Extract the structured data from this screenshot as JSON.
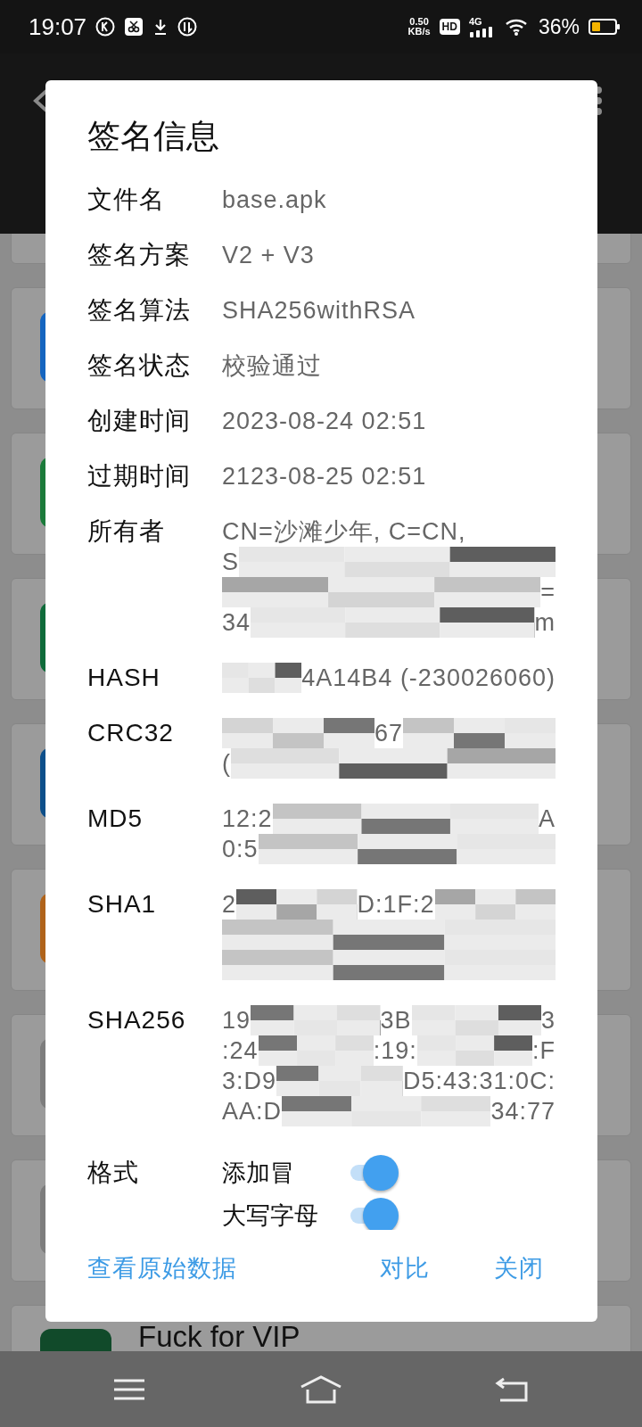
{
  "status_bar": {
    "time": "19:07",
    "net_speed": "0.50",
    "net_unit": "KB/s",
    "hd": "HD",
    "network": "4G",
    "battery": "36%"
  },
  "background_list": {
    "cards": [
      {
        "kind": "partial"
      },
      {
        "color": "#1565c0"
      },
      {
        "color": "#1b7a3a"
      },
      {
        "color": "#0f6b3a"
      },
      {
        "color": "#0d4f8a"
      },
      {
        "color": "#b0631a"
      },
      {
        "color": "#7d7d7d"
      },
      {
        "color": "#7d7d7d"
      },
      {
        "color": "#114a2a",
        "title": "Fuck for VIP"
      }
    ]
  },
  "dialog": {
    "title": "签名信息",
    "rows": [
      {
        "label": "文件名",
        "lines": [
          [
            {
              "kind": "text",
              "text": "base.apk"
            }
          ]
        ]
      },
      {
        "label": "签名方案",
        "lines": [
          [
            {
              "kind": "text",
              "text": "V2 + V3"
            }
          ]
        ]
      },
      {
        "label": "签名算法",
        "lines": [
          [
            {
              "kind": "text",
              "text": "SHA256withRSA"
            }
          ]
        ]
      },
      {
        "label": "签名状态",
        "lines": [
          [
            {
              "kind": "text",
              "text": "校验通过"
            }
          ]
        ]
      },
      {
        "label": "创建时间",
        "lines": [
          [
            {
              "kind": "text",
              "text": "2023-08-24 02:51"
            }
          ]
        ]
      },
      {
        "label": "过期时间",
        "lines": [
          [
            {
              "kind": "text",
              "text": "2123-08-25 02:51"
            }
          ]
        ]
      },
      {
        "label": "所有者",
        "lines": [
          [
            {
              "kind": "text",
              "text": "CN=沙滩少年, C=CN,"
            }
          ],
          [
            {
              "kind": "text",
              "text": "S"
            },
            {
              "kind": "mosaic"
            }
          ],
          [
            {
              "kind": "mosaic"
            },
            {
              "kind": "text",
              "text": "="
            }
          ],
          [
            {
              "kind": "text",
              "text": "34"
            },
            {
              "kind": "mosaic"
            },
            {
              "kind": "text",
              "text": "m"
            }
          ]
        ]
      },
      {
        "label": "HASH",
        "lines": [
          [
            {
              "kind": "mosaic"
            },
            {
              "kind": "text",
              "text": "4A14B4 (-230026060)"
            }
          ]
        ]
      },
      {
        "label": "CRC32",
        "lines": [
          [
            {
              "kind": "mosaic"
            },
            {
              "kind": "text",
              "text": "67"
            },
            {
              "kind": "mosaic"
            }
          ],
          [
            {
              "kind": "text",
              "text": "("
            },
            {
              "kind": "mosaic"
            }
          ]
        ]
      },
      {
        "label": "MD5",
        "lines": [
          [
            {
              "kind": "text",
              "text": "12:2"
            },
            {
              "kind": "mosaic"
            },
            {
              "kind": "text",
              "text": "A"
            }
          ],
          [
            {
              "kind": "text",
              "text": "0:5"
            },
            {
              "kind": "mosaic"
            }
          ]
        ]
      },
      {
        "label": "SHA1",
        "lines": [
          [
            {
              "kind": "text",
              "text": "2"
            },
            {
              "kind": "mosaic"
            },
            {
              "kind": "text",
              "text": "D:1F:2"
            },
            {
              "kind": "mosaic"
            }
          ],
          [
            {
              "kind": "mosaic"
            }
          ],
          [
            {
              "kind": "mosaic"
            }
          ]
        ]
      },
      {
        "label": "SHA256",
        "lines": [
          [
            {
              "kind": "text",
              "text": "19"
            },
            {
              "kind": "mosaic"
            },
            {
              "kind": "text",
              "text": "3B"
            },
            {
              "kind": "mosaic"
            },
            {
              "kind": "text",
              "text": "3"
            }
          ],
          [
            {
              "kind": "text",
              "text": ":24"
            },
            {
              "kind": "mosaic"
            },
            {
              "kind": "text",
              "text": ":19:"
            },
            {
              "kind": "mosaic"
            },
            {
              "kind": "text",
              "text": ":F"
            }
          ],
          [
            {
              "kind": "text",
              "text": "3:D9"
            },
            {
              "kind": "mosaic"
            },
            {
              "kind": "text",
              "text": "D5:43:31:0C:"
            }
          ],
          [
            {
              "kind": "text",
              "text": "AA:D"
            },
            {
              "kind": "mosaic"
            },
            {
              "kind": "text",
              "text": "34:77"
            }
          ]
        ]
      }
    ],
    "format": {
      "label": "格式",
      "options": [
        {
          "label": "添加冒",
          "checked": true
        },
        {
          "label": "大写字母",
          "checked": true
        }
      ]
    },
    "buttons": [
      {
        "label": "查看原始数据"
      },
      {
        "label": "对比"
      },
      {
        "label": "关闭"
      }
    ]
  }
}
